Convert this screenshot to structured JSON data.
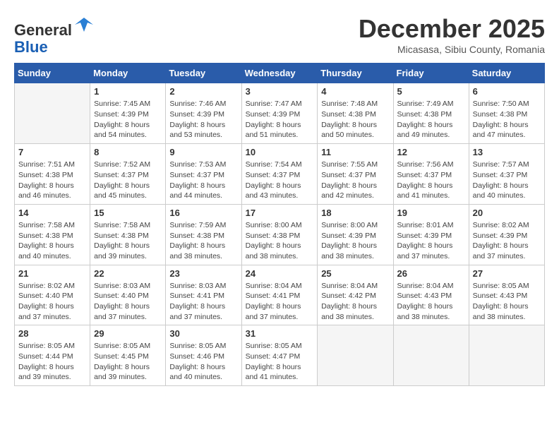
{
  "logo": {
    "line1": "General",
    "line2": "Blue"
  },
  "title": "December 2025",
  "location": "Micasasa, Sibiu County, Romania",
  "weekdays": [
    "Sunday",
    "Monday",
    "Tuesday",
    "Wednesday",
    "Thursday",
    "Friday",
    "Saturday"
  ],
  "weeks": [
    [
      {
        "day": "",
        "info": ""
      },
      {
        "day": "1",
        "info": "Sunrise: 7:45 AM\nSunset: 4:39 PM\nDaylight: 8 hours\nand 54 minutes."
      },
      {
        "day": "2",
        "info": "Sunrise: 7:46 AM\nSunset: 4:39 PM\nDaylight: 8 hours\nand 53 minutes."
      },
      {
        "day": "3",
        "info": "Sunrise: 7:47 AM\nSunset: 4:39 PM\nDaylight: 8 hours\nand 51 minutes."
      },
      {
        "day": "4",
        "info": "Sunrise: 7:48 AM\nSunset: 4:38 PM\nDaylight: 8 hours\nand 50 minutes."
      },
      {
        "day": "5",
        "info": "Sunrise: 7:49 AM\nSunset: 4:38 PM\nDaylight: 8 hours\nand 49 minutes."
      },
      {
        "day": "6",
        "info": "Sunrise: 7:50 AM\nSunset: 4:38 PM\nDaylight: 8 hours\nand 47 minutes."
      }
    ],
    [
      {
        "day": "7",
        "info": "Sunrise: 7:51 AM\nSunset: 4:38 PM\nDaylight: 8 hours\nand 46 minutes."
      },
      {
        "day": "8",
        "info": "Sunrise: 7:52 AM\nSunset: 4:37 PM\nDaylight: 8 hours\nand 45 minutes."
      },
      {
        "day": "9",
        "info": "Sunrise: 7:53 AM\nSunset: 4:37 PM\nDaylight: 8 hours\nand 44 minutes."
      },
      {
        "day": "10",
        "info": "Sunrise: 7:54 AM\nSunset: 4:37 PM\nDaylight: 8 hours\nand 43 minutes."
      },
      {
        "day": "11",
        "info": "Sunrise: 7:55 AM\nSunset: 4:37 PM\nDaylight: 8 hours\nand 42 minutes."
      },
      {
        "day": "12",
        "info": "Sunrise: 7:56 AM\nSunset: 4:37 PM\nDaylight: 8 hours\nand 41 minutes."
      },
      {
        "day": "13",
        "info": "Sunrise: 7:57 AM\nSunset: 4:37 PM\nDaylight: 8 hours\nand 40 minutes."
      }
    ],
    [
      {
        "day": "14",
        "info": "Sunrise: 7:58 AM\nSunset: 4:38 PM\nDaylight: 8 hours\nand 40 minutes."
      },
      {
        "day": "15",
        "info": "Sunrise: 7:58 AM\nSunset: 4:38 PM\nDaylight: 8 hours\nand 39 minutes."
      },
      {
        "day": "16",
        "info": "Sunrise: 7:59 AM\nSunset: 4:38 PM\nDaylight: 8 hours\nand 38 minutes."
      },
      {
        "day": "17",
        "info": "Sunrise: 8:00 AM\nSunset: 4:38 PM\nDaylight: 8 hours\nand 38 minutes."
      },
      {
        "day": "18",
        "info": "Sunrise: 8:00 AM\nSunset: 4:39 PM\nDaylight: 8 hours\nand 38 minutes."
      },
      {
        "day": "19",
        "info": "Sunrise: 8:01 AM\nSunset: 4:39 PM\nDaylight: 8 hours\nand 37 minutes."
      },
      {
        "day": "20",
        "info": "Sunrise: 8:02 AM\nSunset: 4:39 PM\nDaylight: 8 hours\nand 37 minutes."
      }
    ],
    [
      {
        "day": "21",
        "info": "Sunrise: 8:02 AM\nSunset: 4:40 PM\nDaylight: 8 hours\nand 37 minutes."
      },
      {
        "day": "22",
        "info": "Sunrise: 8:03 AM\nSunset: 4:40 PM\nDaylight: 8 hours\nand 37 minutes."
      },
      {
        "day": "23",
        "info": "Sunrise: 8:03 AM\nSunset: 4:41 PM\nDaylight: 8 hours\nand 37 minutes."
      },
      {
        "day": "24",
        "info": "Sunrise: 8:04 AM\nSunset: 4:41 PM\nDaylight: 8 hours\nand 37 minutes."
      },
      {
        "day": "25",
        "info": "Sunrise: 8:04 AM\nSunset: 4:42 PM\nDaylight: 8 hours\nand 38 minutes."
      },
      {
        "day": "26",
        "info": "Sunrise: 8:04 AM\nSunset: 4:43 PM\nDaylight: 8 hours\nand 38 minutes."
      },
      {
        "day": "27",
        "info": "Sunrise: 8:05 AM\nSunset: 4:43 PM\nDaylight: 8 hours\nand 38 minutes."
      }
    ],
    [
      {
        "day": "28",
        "info": "Sunrise: 8:05 AM\nSunset: 4:44 PM\nDaylight: 8 hours\nand 39 minutes."
      },
      {
        "day": "29",
        "info": "Sunrise: 8:05 AM\nSunset: 4:45 PM\nDaylight: 8 hours\nand 39 minutes."
      },
      {
        "day": "30",
        "info": "Sunrise: 8:05 AM\nSunset: 4:46 PM\nDaylight: 8 hours\nand 40 minutes."
      },
      {
        "day": "31",
        "info": "Sunrise: 8:05 AM\nSunset: 4:47 PM\nDaylight: 8 hours\nand 41 minutes."
      },
      {
        "day": "",
        "info": ""
      },
      {
        "day": "",
        "info": ""
      },
      {
        "day": "",
        "info": ""
      }
    ]
  ]
}
